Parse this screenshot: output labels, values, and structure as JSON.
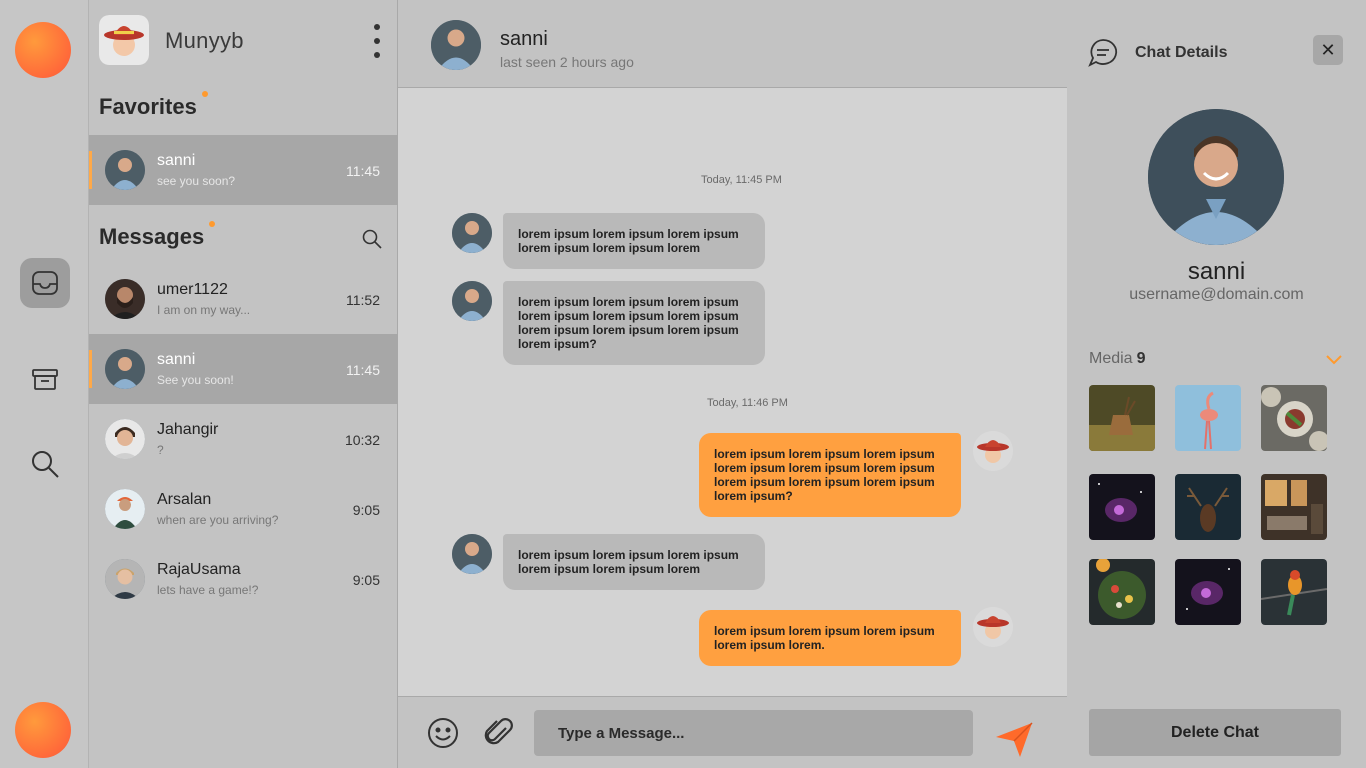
{
  "app": {
    "user_name": "Munyyb"
  },
  "colors": {
    "accent": "#ffa040",
    "active_item": "#a7a7a7",
    "panel": "#c3c3c3"
  },
  "rail": {
    "icons": [
      "inbox-icon",
      "archive-icon",
      "search-icon"
    ]
  },
  "favorites": {
    "title": "Favorites",
    "items": [
      {
        "name": "sanni",
        "preview": "see you soon?",
        "time": "11:45"
      }
    ]
  },
  "messages": {
    "title": "Messages",
    "items": [
      {
        "name": "umer1122",
        "preview": "I am on my way...",
        "time": "11:52"
      },
      {
        "name": "sanni",
        "preview": "See you soon!",
        "time": "11:45"
      },
      {
        "name": "Jahangir",
        "preview": "?",
        "time": "10:32"
      },
      {
        "name": "Arsalan",
        "preview": "when are you arriving?",
        "time": "9:05"
      },
      {
        "name": "RajaUsama",
        "preview": "lets have a game!?",
        "time": "9:05"
      }
    ]
  },
  "chat": {
    "name": "sanni",
    "status": "last seen 2 hours ago",
    "dates": [
      "Today, 11:45 PM",
      "Today, 11:46 PM"
    ],
    "messages": [
      {
        "dir": "in",
        "text": "lorem ipsum lorem ipsum lorem ipsum lorem ipsum lorem ipsum lorem"
      },
      {
        "dir": "in",
        "text": "lorem ipsum lorem ipsum lorem ipsum lorem ipsum lorem ipsum lorem ipsum lorem ipsum lorem ipsum lorem ipsum lorem ipsum?"
      },
      {
        "dir": "out",
        "text": "lorem ipsum lorem ipsum lorem ipsum lorem ipsum lorem ipsum lorem ipsum lorem ipsum lorem ipsum lorem ipsum lorem ipsum?"
      },
      {
        "dir": "in",
        "text": "lorem ipsum lorem ipsum lorem ipsum lorem ipsum lorem ipsum lorem"
      },
      {
        "dir": "out",
        "text": "lorem ipsum lorem ipsum lorem ipsum lorem ipsum lorem."
      }
    ],
    "composer": {
      "placeholder": "Type a Message..."
    }
  },
  "details": {
    "title": "Chat Details",
    "name": "sanni",
    "username": "username@domain.com",
    "media_label": "Media",
    "media_count": "9",
    "media": [
      "deer",
      "flamingo",
      "food-plates",
      "nebula",
      "deer-dark",
      "living-room",
      "salad",
      "nebula",
      "parrot"
    ],
    "delete_label": "Delete Chat"
  }
}
